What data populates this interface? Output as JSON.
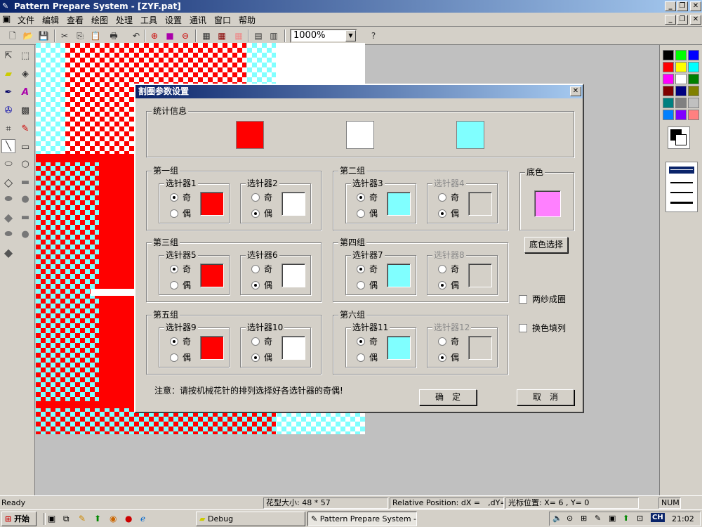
{
  "app": {
    "title": "Pattern Prepare System - [ZYF.pat]"
  },
  "menu": [
    "文件",
    "编辑",
    "查看",
    "绘图",
    "处理",
    "工具",
    "设置",
    "通讯",
    "窗口",
    "帮助"
  ],
  "toolbar": {
    "zoom_value": "1000%"
  },
  "dialog": {
    "title": "割圈参数设置",
    "stats_label": "统计信息",
    "stats_colors": [
      "#ff0000",
      "#ffffff",
      "#80ffff"
    ],
    "base_label": "底色",
    "base_color": "#ff80ff",
    "base_button": "底色选择",
    "opt_two_yarn": "两纱成圈",
    "opt_color_fill": "换色填列",
    "note": "注意：请按机械花针的排列选择好各选针器的奇偶!",
    "ok": "确　定",
    "cancel": "取　消",
    "odd": "奇",
    "even": "偶",
    "groups": [
      {
        "name": "第一组",
        "selectors": [
          {
            "label": "选针器1",
            "enabled": true,
            "sel": "odd",
            "color": "#ff0000"
          },
          {
            "label": "选针器2",
            "enabled": true,
            "sel": "even",
            "color": "#ffffff"
          }
        ]
      },
      {
        "name": "第二组",
        "selectors": [
          {
            "label": "选针器3",
            "enabled": true,
            "sel": "odd",
            "color": "#80ffff"
          },
          {
            "label": "选针器4",
            "enabled": false,
            "sel": "even",
            "color": "#d4d0c8"
          }
        ]
      },
      {
        "name": "第三组",
        "selectors": [
          {
            "label": "选针器5",
            "enabled": true,
            "sel": "odd",
            "color": "#ff0000"
          },
          {
            "label": "选针器6",
            "enabled": true,
            "sel": "even",
            "color": "#ffffff"
          }
        ]
      },
      {
        "name": "第四组",
        "selectors": [
          {
            "label": "选针器7",
            "enabled": true,
            "sel": "odd",
            "color": "#80ffff"
          },
          {
            "label": "选针器8",
            "enabled": false,
            "sel": "even",
            "color": "#d4d0c8"
          }
        ]
      },
      {
        "name": "第五组",
        "selectors": [
          {
            "label": "选针器9",
            "enabled": true,
            "sel": "odd",
            "color": "#ff0000"
          },
          {
            "label": "选针器10",
            "enabled": true,
            "sel": "even",
            "color": "#ffffff"
          }
        ]
      },
      {
        "name": "第六组",
        "selectors": [
          {
            "label": "选针器11",
            "enabled": true,
            "sel": "odd",
            "color": "#80ffff"
          },
          {
            "label": "选针器12",
            "enabled": false,
            "sel": "even",
            "color": "#d4d0c8"
          }
        ]
      }
    ]
  },
  "palette": [
    "#000000",
    "#00ff00",
    "#0000ff",
    "#ff0000",
    "#ffff00",
    "#00ffff",
    "#ff00ff",
    "#ffffff",
    "#008000",
    "#800000",
    "#000080",
    "#808000",
    "#008080",
    "#808080",
    "#c0c0c0",
    "#0080ff",
    "#8000ff",
    "#ff8080"
  ],
  "status": {
    "ready": "Ready",
    "size": "花型大小: 48 * 57",
    "relpos": "Relative Position: dX =　,dY=　.",
    "cursor": "光标位置: X= 6 , Y= 0",
    "num": "NUM"
  },
  "taskbar": {
    "start": "开始",
    "task1": "Debug",
    "task2": "Pattern Prepare System -...",
    "lang": "CH",
    "time": "21:02"
  },
  "colors": {
    "red": "#ff0000",
    "cyan": "#80ffff",
    "white": "#ffffff"
  }
}
